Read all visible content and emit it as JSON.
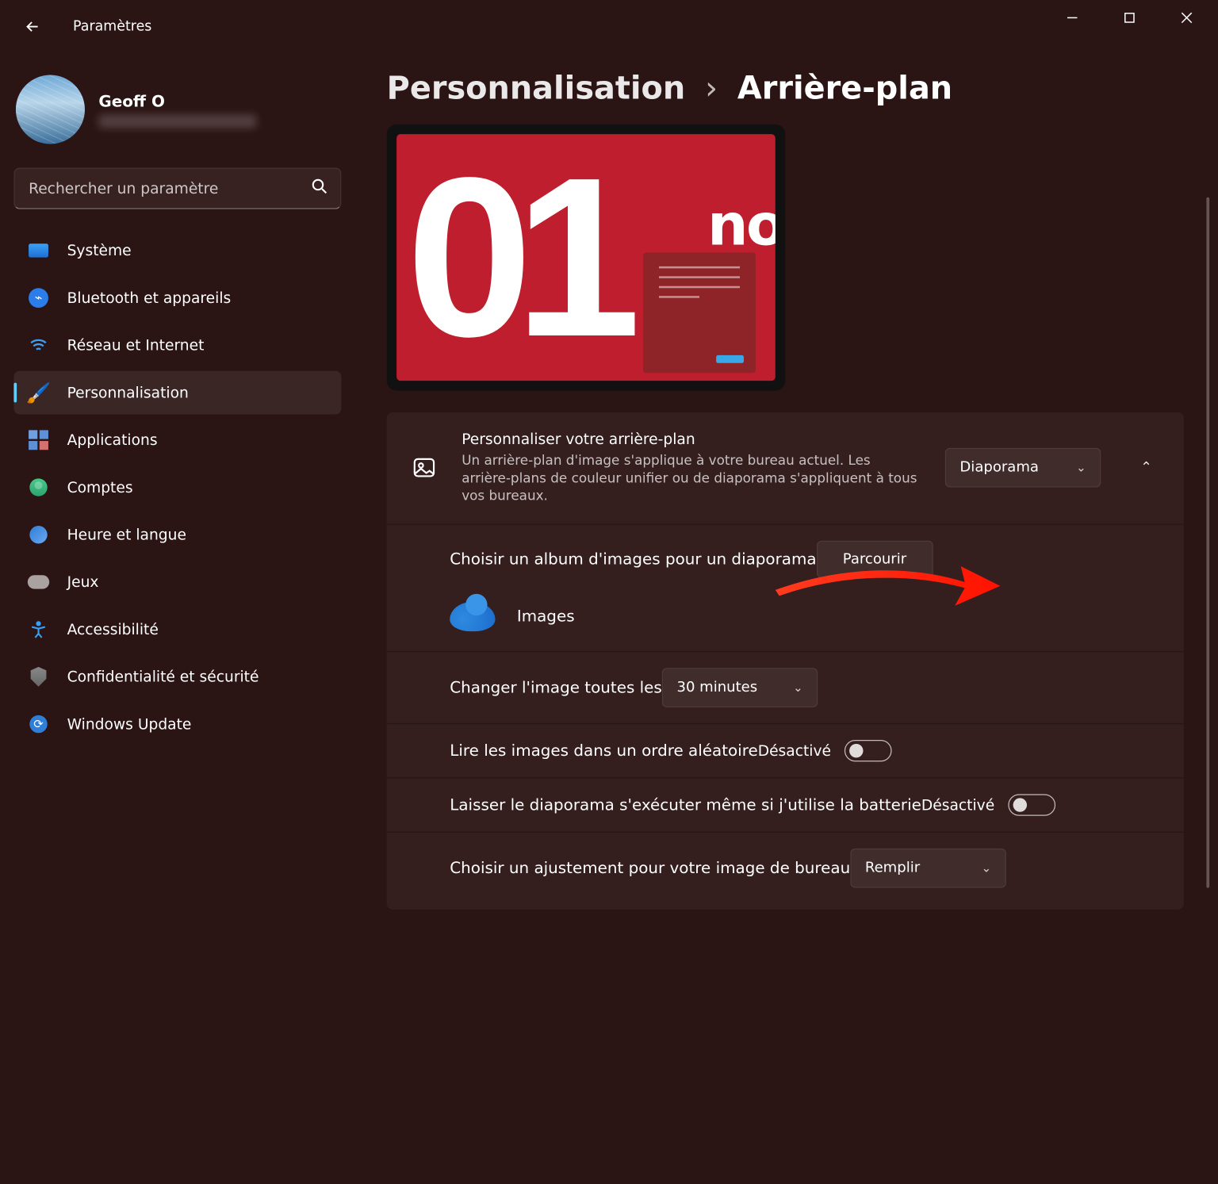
{
  "window": {
    "title": "Paramètres"
  },
  "user": {
    "name": "Geoff O"
  },
  "search": {
    "placeholder": "Rechercher un paramètre"
  },
  "nav": {
    "system": "Système",
    "bluetooth": "Bluetooth et appareils",
    "network": "Réseau et Internet",
    "personalization": "Personnalisation",
    "apps": "Applications",
    "accounts": "Comptes",
    "time": "Heure et langue",
    "gaming": "Jeux",
    "accessibility": "Accessibilité",
    "privacy": "Confidentialité et sécurité",
    "update": "Windows Update"
  },
  "breadcrumb": {
    "parent": "Personnalisation",
    "current": "Arrière-plan"
  },
  "preview": {
    "digits": "01",
    "brand_suffix": "not"
  },
  "settings": {
    "personalize": {
      "title": "Personnaliser votre arrière-plan",
      "desc": "Un arrière-plan d'image s'applique à votre bureau actuel. Les arrière-plans de couleur unifier ou de diaporama s'appliquent à tous vos bureaux.",
      "value": "Diaporama"
    },
    "choose_album": {
      "title": "Choisir un album d'images pour un diaporama",
      "browse": "Parcourir",
      "folder_name": "Images"
    },
    "change_every": {
      "title": "Changer l'image toutes les",
      "value": "30 minutes"
    },
    "shuffle": {
      "title": "Lire les images dans un ordre aléatoire",
      "state": "Désactivé"
    },
    "battery": {
      "title": "Laisser le diaporama s'exécuter même si j'utilise la batterie",
      "state": "Désactivé"
    },
    "fit": {
      "title": "Choisir un ajustement pour votre image de bureau",
      "value": "Remplir"
    }
  }
}
